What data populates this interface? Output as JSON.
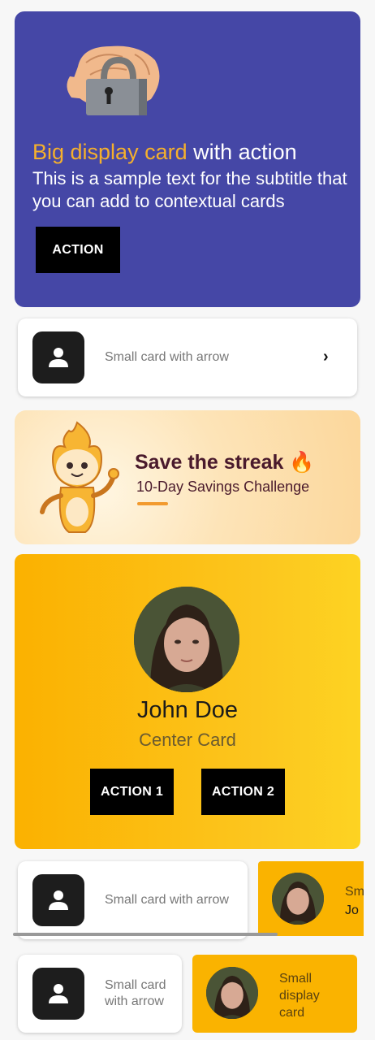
{
  "big_card": {
    "title_accent": "Big display card",
    "title_rest": " with action",
    "subtitle": "This is a sample text for the subtitle that you can add to contextual cards",
    "action_label": "ACTION",
    "bg_color": "#4547a6",
    "accent_color": "#f5b02c"
  },
  "small_card_1": {
    "label": "Small card with arrow",
    "icon": "person-icon",
    "arrow": "›"
  },
  "streak_banner": {
    "title": "Save the streak 🔥",
    "subtitle": "10-Day Savings Challenge"
  },
  "center_card": {
    "name": "John Doe",
    "subtitle": "Center Card",
    "action1": "ACTION 1",
    "action2": "ACTION 2"
  },
  "carousel": {
    "card_label": "Small card with arrow",
    "peek_line1": "Sm",
    "peek_line2": "Jo"
  },
  "bottom_row": {
    "left_label": "Small card with arrow",
    "right_label": "Small display card"
  }
}
